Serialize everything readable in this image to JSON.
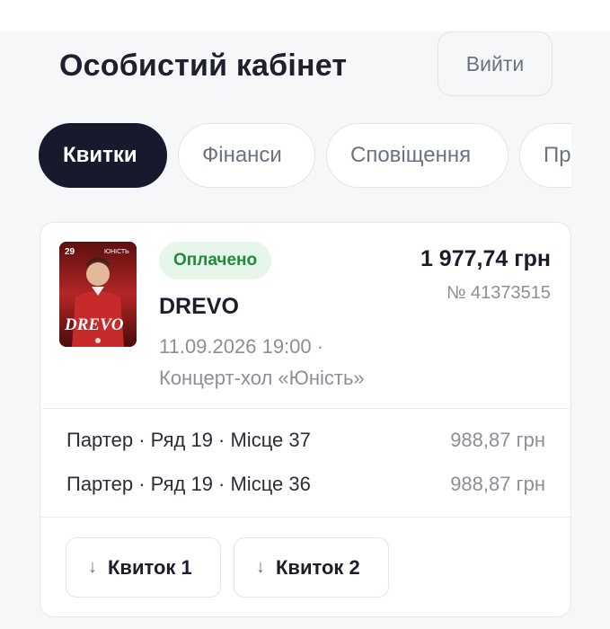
{
  "header": {
    "title": "Особистий кабінет",
    "logout_label": "Вийти"
  },
  "tabs": [
    {
      "label": "Квитки",
      "active": true
    },
    {
      "label": "Фінанси",
      "active": false
    },
    {
      "label": "Сповіщення",
      "active": false
    },
    {
      "label": "Пр",
      "active": false
    }
  ],
  "order": {
    "status": "Оплачено",
    "total": "1 977,74 грн",
    "number": "№ 41373515",
    "event": "DREVO",
    "datetime": "11.09.2026 19:00 ·",
    "venue": "Концерт-хол «Юність»",
    "poster": {
      "date_text": "29",
      "venue_text": "ЮНІСТЬ",
      "artist_text": "DREVO"
    },
    "seats": [
      {
        "label": "Партер · Ряд 19 · Місце 37",
        "price": "988,87 грн"
      },
      {
        "label": "Партер · Ряд 19 · Місце 36",
        "price": "988,87 грн"
      }
    ],
    "tickets": [
      {
        "icon": "download-arrow-icon",
        "label": "Квиток 1"
      },
      {
        "icon": "download-arrow-icon",
        "label": "Квиток 2"
      }
    ]
  },
  "colors": {
    "active_tab": "#161a2c",
    "status_bg": "#e6f6ea",
    "status_text": "#1f8a3a",
    "page_bg": "#f6f7f9"
  }
}
